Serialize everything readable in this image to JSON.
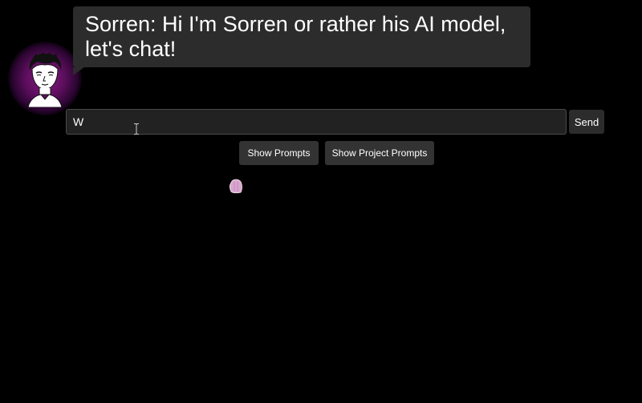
{
  "chat": {
    "bot_message": "Sorren: Hi I'm Sorren or rather his AI model, let's chat!",
    "input_value": "W",
    "send_label": "Send"
  },
  "prompts": {
    "show_prompts_label": "Show Prompts",
    "show_project_prompts_label": "Show Project Prompts"
  },
  "icons": {
    "avatar": "avatar-portrait",
    "text_cursor": "i-beam-cursor-icon",
    "mouse_cursor": "mouse-pointer-icon"
  },
  "colors": {
    "background": "#000000",
    "bubble": "#2c2c2c",
    "avatar_glow": "#8a1a86",
    "button": "#333333",
    "input_bg": "#222222"
  }
}
